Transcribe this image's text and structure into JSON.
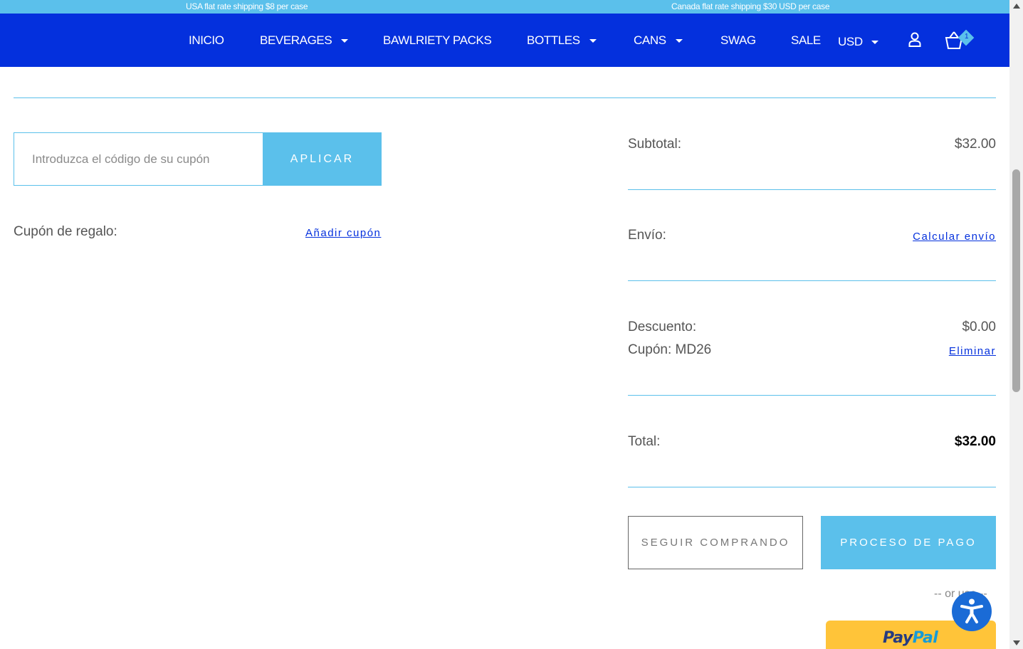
{
  "promo": {
    "left": "USA flat rate shipping $8 per case",
    "right": "Canada flat rate shipping $30 USD per case"
  },
  "nav": {
    "items": [
      "INICIO",
      "BEVERAGES",
      "BAWLRIETY PACKS",
      "BOTTLES",
      "CANS",
      "SWAG",
      "SALE"
    ],
    "currency": "USD",
    "cart_count": "1"
  },
  "coupon": {
    "placeholder": "Introduzca el código de su cupón",
    "apply_label": "APLICAR",
    "gift_label": "Cupón de regalo:",
    "add_link": "Añadir cupón"
  },
  "summary": {
    "subtotal_label": "Subtotal:",
    "subtotal_value": "$32.00",
    "shipping_label": "Envío:",
    "shipping_link": "Calcular envío",
    "discount_label": "Descuento:",
    "discount_value": "$0.00",
    "coupon_label": "Cupón: MD26",
    "remove_link": "Eliminar",
    "total_label": "Total:",
    "total_value": "$32.00"
  },
  "actions": {
    "continue_label": "SEGUIR COMPRANDO",
    "checkout_label": "PROCESO DE PAGO",
    "or_text": "-- or use --",
    "paypal_a": "Pay",
    "paypal_b": "Pal"
  },
  "colors": {
    "nav_bg": "#0430dd",
    "promo_bg": "#5bc0eb",
    "accent": "#5bc0eb",
    "link": "#0430dd",
    "paypal": "#ffc439"
  }
}
